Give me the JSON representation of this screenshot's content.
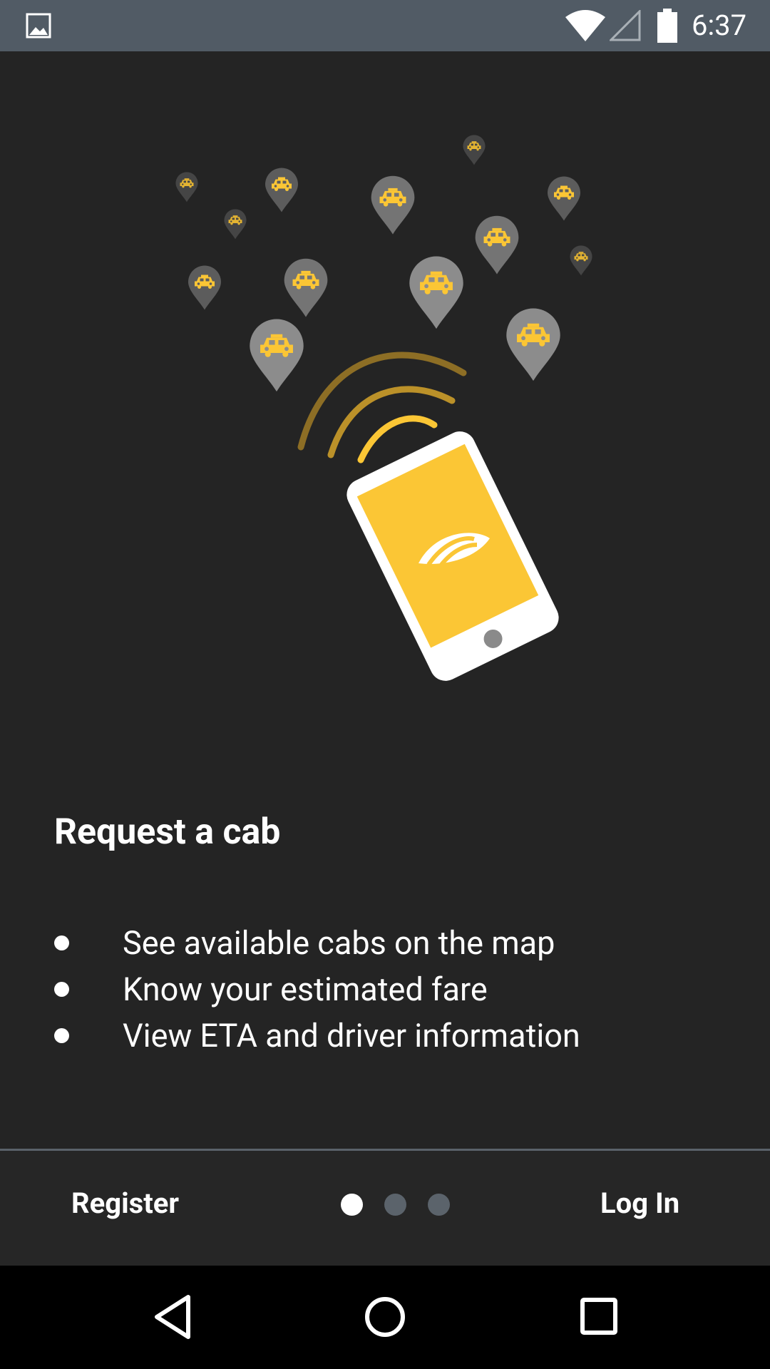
{
  "status_bar": {
    "time": "6:37",
    "icons": [
      "image-icon",
      "wifi-icon",
      "signal-icon",
      "battery-icon"
    ]
  },
  "intro": {
    "title": "Request a cab",
    "features": [
      "See available cabs on the map",
      "Know your estimated fare",
      "View ETA and driver information"
    ]
  },
  "bottom_bar": {
    "register_label": "Register",
    "login_label": "Log In",
    "page_count": 3,
    "active_page": 1
  },
  "nav_bar": {
    "buttons": [
      "back-icon",
      "home-icon",
      "recents-icon"
    ]
  },
  "colors": {
    "background": "#242424",
    "status_bar": "#515b65",
    "accent_yellow": "#fbc635",
    "pin_gray": "#8a8a8a",
    "text": "#ffffff",
    "dot_inactive": "#5b636b"
  }
}
